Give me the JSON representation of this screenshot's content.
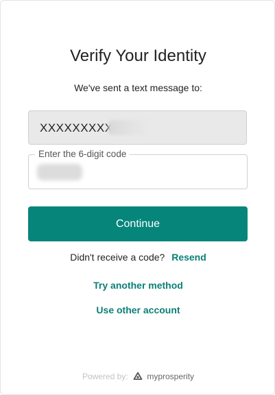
{
  "header": {
    "title": "Verify Your Identity",
    "subtitle": "We've sent a text message to:"
  },
  "phone": {
    "masked_value": "XXXXXXXXX"
  },
  "code_field": {
    "label": "Enter the 6-digit code"
  },
  "actions": {
    "continue_label": "Continue",
    "resend_prompt": "Didn't receive a code?",
    "resend_label": "Resend",
    "try_another_label": "Try another method",
    "other_account_label": "Use other account"
  },
  "footer": {
    "powered_by": "Powered by:",
    "brand_name": "myprosperity",
    "brand_icon": "myprosperity-logo-icon"
  },
  "colors": {
    "primary": "#06857b",
    "link": "#0b7f76",
    "text": "#222222"
  }
}
